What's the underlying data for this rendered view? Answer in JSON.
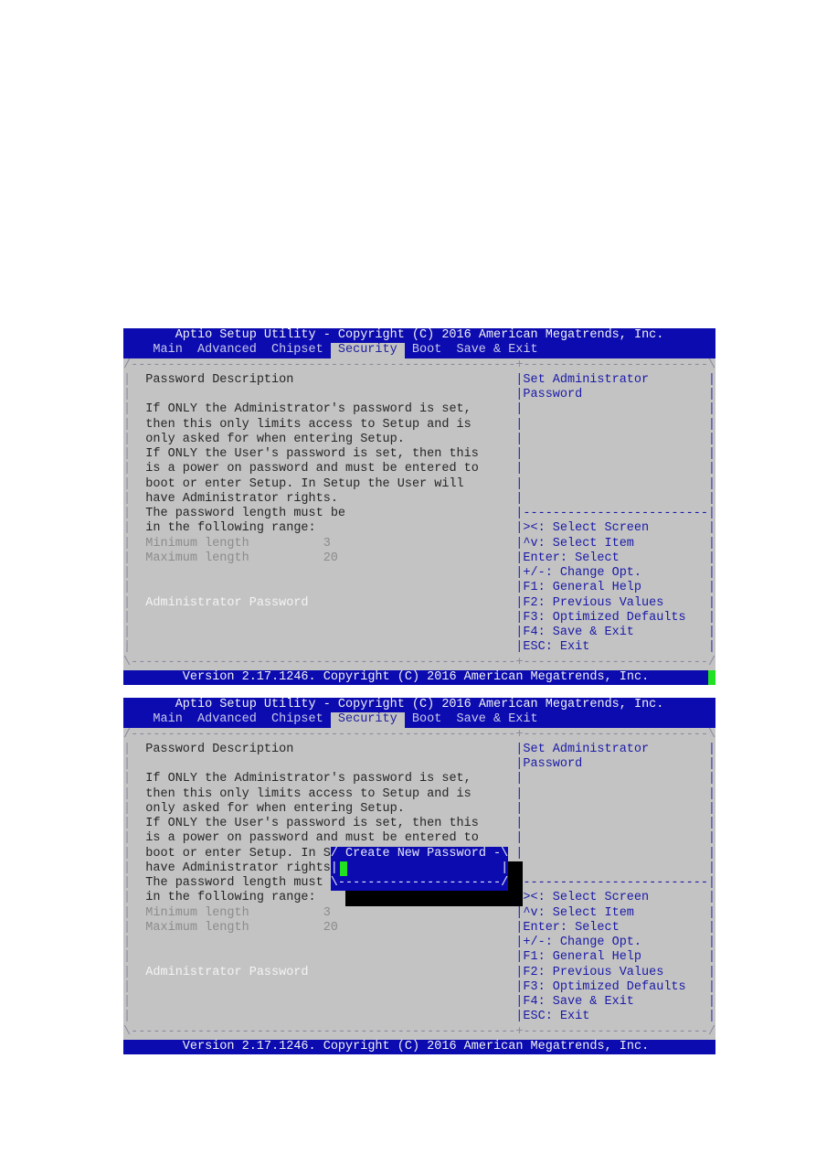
{
  "screens": [
    {
      "title": "Aptio Setup Utility - Copyright (C) 2016 American Megatrends, Inc.",
      "tabs": [
        {
          "label": "Main",
          "selected": false
        },
        {
          "label": "Advanced",
          "selected": false
        },
        {
          "label": "Chipset",
          "selected": false
        },
        {
          "label": "Security",
          "selected": true
        },
        {
          "label": "Boot",
          "selected": false
        },
        {
          "label": "Save & Exit",
          "selected": false
        }
      ],
      "heading": "Password Description",
      "description": [
        "If ONLY the Administrator's password is set,",
        "then this only limits access to Setup and is",
        "only asked for when entering Setup.",
        "If ONLY the User's password is set, then this",
        "is a power on password and must be entered to",
        "boot or enter Setup. In Setup the User will",
        "have Administrator rights.",
        "The password length must be",
        "in the following range:"
      ],
      "min_label": "Minimum length",
      "min_value": "3",
      "max_label": "Maximum length",
      "max_value": "20",
      "item": "Administrator Password",
      "help_title": [
        "Set Administrator",
        "Password"
      ],
      "keys": [
        "><: Select Screen",
        "^v: Select Item",
        "Enter: Select",
        "+/-: Change Opt.",
        "F1: General Help",
        "F2: Previous Values",
        "F3: Optimized Defaults",
        "F4: Save & Exit",
        "ESC: Exit"
      ],
      "footer": "Version 2.17.1246. Copyright (C) 2016 American Megatrends, Inc.",
      "popup": null
    },
    {
      "title": "Aptio Setup Utility - Copyright (C) 2016 American Megatrends, Inc.",
      "tabs": [
        {
          "label": "Main",
          "selected": false
        },
        {
          "label": "Advanced",
          "selected": false
        },
        {
          "label": "Chipset",
          "selected": false
        },
        {
          "label": "Security",
          "selected": true
        },
        {
          "label": "Boot",
          "selected": false
        },
        {
          "label": "Save & Exit",
          "selected": false
        }
      ],
      "heading": "Password Description",
      "description": [
        "If ONLY the Administrator's password is set,",
        "then this only limits access to Setup and is",
        "only asked for when entering Setup.",
        "If ONLY the User's password is set, then this",
        "is a power on password and must be entered to",
        "boot or enter Setup. In S",
        "have Administrator rights",
        "The password length must",
        "in the following range:"
      ],
      "min_label": "Minimum length",
      "min_value": "3",
      "max_label": "Maximum length",
      "max_value": "20",
      "item": "Administrator Password",
      "help_title": [
        "Set Administrator",
        "Password"
      ],
      "keys": [
        "><: Select Screen",
        "^v: Select Item",
        "Enter: Select",
        "+/-: Change Opt.",
        "F1: General Help",
        "F2: Previous Values",
        "F3: Optimized Defaults",
        "F4: Save & Exit",
        "ESC: Exit"
      ],
      "footer": "Version 2.17.1246. Copyright (C) 2016 American Megatrends, Inc.",
      "popup": {
        "title": "Create New Password",
        "value": ""
      }
    }
  ],
  "colors": {
    "bar": "#0b0bb0",
    "background": "#c3c3c3",
    "help_text": "#1a1aa8",
    "cursor": "#22e022"
  }
}
